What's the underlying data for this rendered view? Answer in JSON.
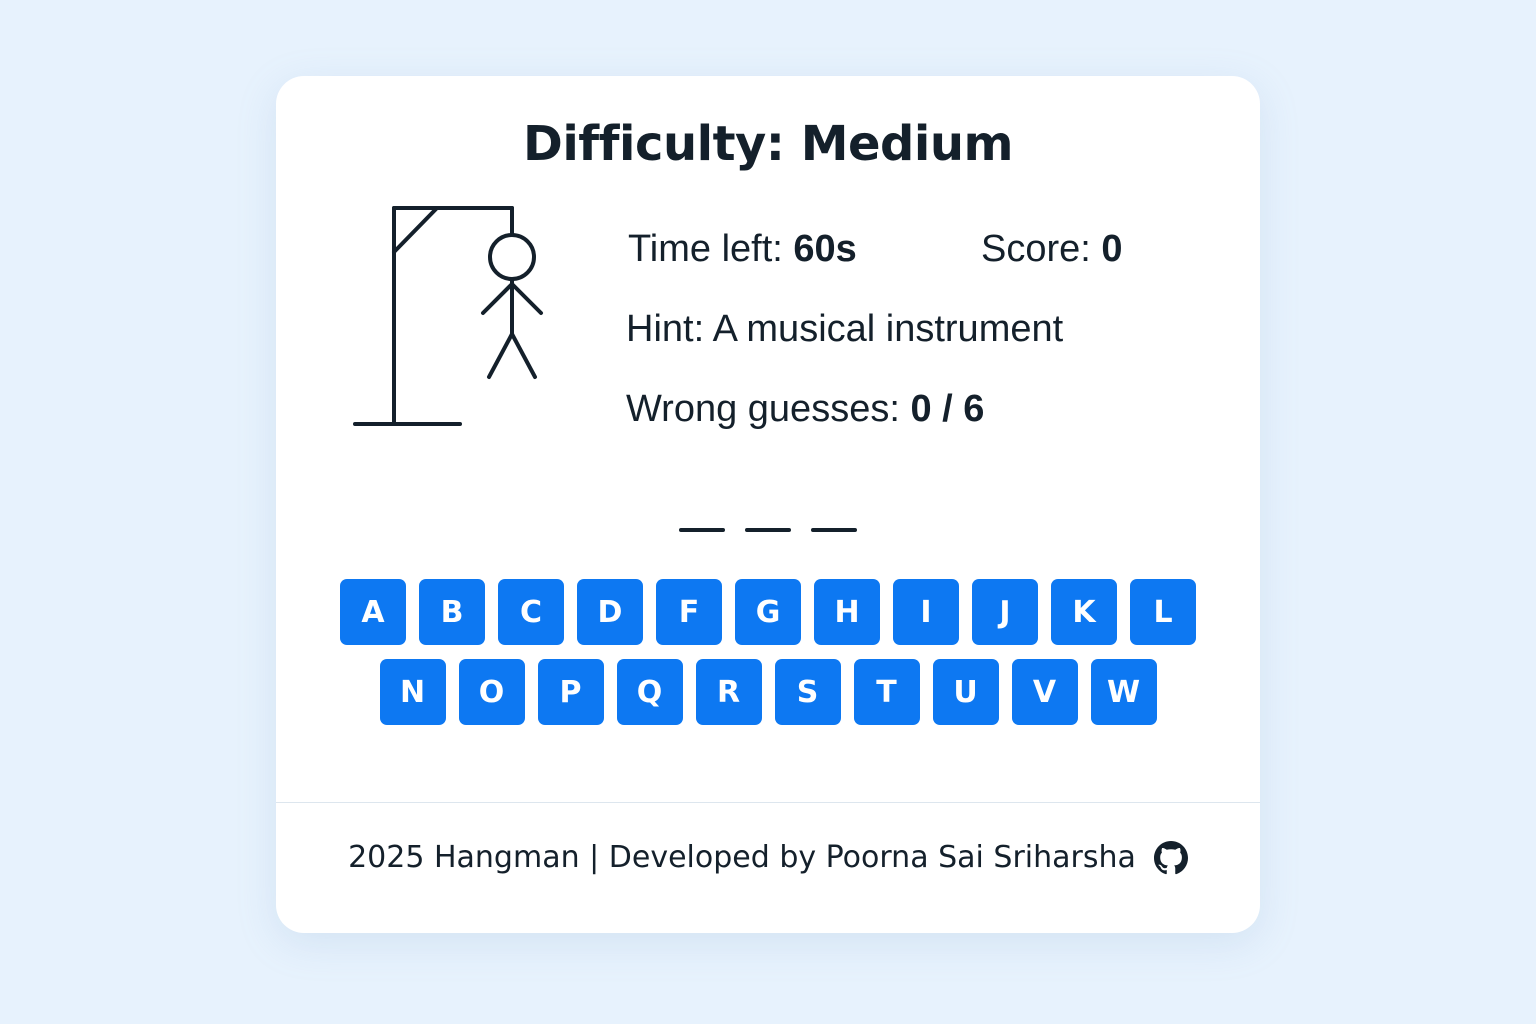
{
  "game": {
    "difficulty_label": "Difficulty: Medium",
    "time_label": "Time left: ",
    "time_value": "60s",
    "score_label": "Score: ",
    "score_value": "0",
    "hint_label": "Hint: A musical instrument",
    "wrong_label": "Wrong guesses: ",
    "wrong_value": "0 / 6",
    "word_blanks": 3
  },
  "keyboard": {
    "row1": [
      "A",
      "B",
      "C",
      "D",
      "F",
      "G",
      "H",
      "I",
      "J",
      "K",
      "L"
    ],
    "row2": [
      "N",
      "O",
      "P",
      "Q",
      "R",
      "S",
      "T",
      "U",
      "V",
      "W"
    ]
  },
  "footer": {
    "text": "2025 Hangman | Developed by Poorna Sai Sriharsha",
    "icon": "github-icon"
  },
  "colors": {
    "background": "#e7f2fd",
    "card": "#ffffff",
    "key": "#0d78f2",
    "text": "#14202b"
  }
}
